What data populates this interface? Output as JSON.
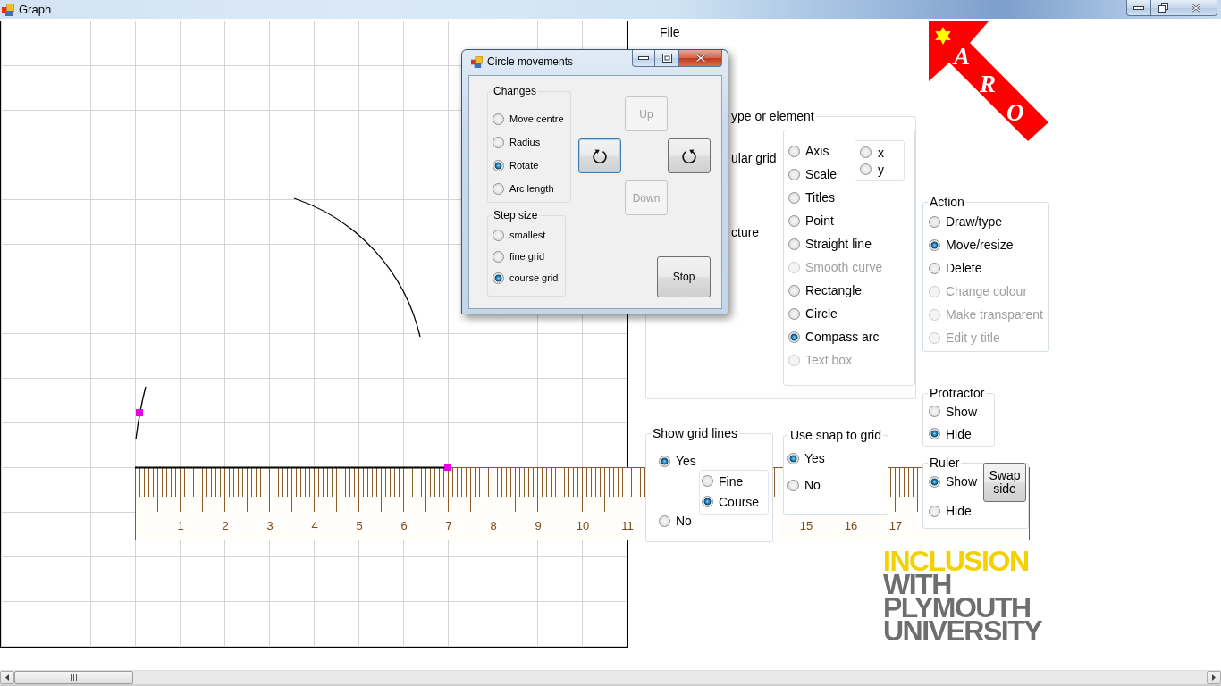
{
  "window": {
    "title": "Graph"
  },
  "menu": [
    {
      "label": "File"
    }
  ],
  "ruler": {
    "numbers": [
      "1",
      "2",
      "3",
      "4",
      "5",
      "6",
      "7",
      "8",
      "9",
      "10",
      "11"
    ],
    "numbers_after_gap": [
      "15",
      "16",
      "17"
    ]
  },
  "object_group": {
    "title": "ype or element",
    "options": [
      {
        "label": "ular grid"
      },
      {
        "label": "cture"
      }
    ],
    "types": [
      {
        "label": "Axis",
        "selected": false,
        "disabled": false
      },
      {
        "label": "Scale",
        "selected": false,
        "disabled": false
      },
      {
        "label": "Titles",
        "selected": false,
        "disabled": false
      },
      {
        "label": "Point",
        "selected": false,
        "disabled": false
      },
      {
        "label": "Straight line",
        "selected": false,
        "disabled": false
      },
      {
        "label": "Smooth curve",
        "selected": false,
        "disabled": true
      },
      {
        "label": "Rectangle",
        "selected": false,
        "disabled": false
      },
      {
        "label": "Circle",
        "selected": false,
        "disabled": false
      },
      {
        "label": "Compass arc",
        "selected": true,
        "disabled": false
      },
      {
        "label": "Text box",
        "selected": false,
        "disabled": true
      }
    ],
    "axis_options": [
      {
        "label": "x",
        "selected": false
      },
      {
        "label": "y",
        "selected": false
      }
    ]
  },
  "action_group": {
    "title": "Action",
    "options": [
      {
        "label": "Draw/type",
        "selected": false,
        "disabled": false
      },
      {
        "label": "Move/resize",
        "selected": true,
        "disabled": false
      },
      {
        "label": "Delete",
        "selected": false,
        "disabled": false
      },
      {
        "label": "Change colour",
        "selected": false,
        "disabled": true
      },
      {
        "label": "Make transparent",
        "selected": false,
        "disabled": true
      },
      {
        "label": "Edit y title",
        "selected": false,
        "disabled": true
      }
    ]
  },
  "protractor_group": {
    "title": "Protractor",
    "options": [
      {
        "label": "Show",
        "selected": false
      },
      {
        "label": "Hide",
        "selected": true
      }
    ]
  },
  "grid_lines_group": {
    "title": "Show grid lines",
    "options": [
      {
        "label": "Yes",
        "selected": true
      },
      {
        "label": "No",
        "selected": false
      }
    ],
    "spacing_options": [
      {
        "label": "Fine",
        "selected": false
      },
      {
        "label": "Course",
        "selected": true
      }
    ]
  },
  "snap_group": {
    "title": "Use snap to grid",
    "options": [
      {
        "label": "Yes",
        "selected": true
      },
      {
        "label": "No",
        "selected": false
      }
    ]
  },
  "ruler_group": {
    "title": "Ruler",
    "options": [
      {
        "label": "Show",
        "selected": true
      },
      {
        "label": "Hide",
        "selected": false
      }
    ],
    "button": {
      "label": "Swap side"
    }
  },
  "aro_logo": {
    "letters": [
      "A",
      "R",
      "O"
    ]
  },
  "university_logo": {
    "lines": [
      {
        "text": "INCLUSION",
        "color": "#f4d100"
      },
      {
        "text": "WITH",
        "color": "#6d6e70"
      },
      {
        "text": "PLYMOUTH",
        "color": "#6d6e70"
      },
      {
        "text": "UNIVERSITY",
        "color": "#6d6e70"
      }
    ]
  },
  "dialog": {
    "title": "Circle movements",
    "changes_group": {
      "title": "Changes",
      "options": [
        {
          "label": "Move centre",
          "selected": false
        },
        {
          "label": "Radius",
          "selected": false
        },
        {
          "label": "Rotate",
          "selected": true
        },
        {
          "label": "Arc length",
          "selected": false
        }
      ]
    },
    "step_group": {
      "title": "Step size",
      "options": [
        {
          "label": "smallest",
          "selected": false
        },
        {
          "label": "fine grid",
          "selected": false
        },
        {
          "label": "course grid",
          "selected": true
        }
      ]
    },
    "buttons": [
      {
        "kind": "text",
        "label": "Up",
        "disabled": true,
        "focused": false
      },
      {
        "kind": "rotate_clockwise",
        "disabled": false,
        "focused": true
      },
      {
        "kind": "rotate_anticlockwise",
        "disabled": false,
        "focused": false
      },
      {
        "kind": "text",
        "label": "Down",
        "disabled": true,
        "focused": false
      }
    ],
    "stop_button": {
      "label": "Stop"
    }
  }
}
